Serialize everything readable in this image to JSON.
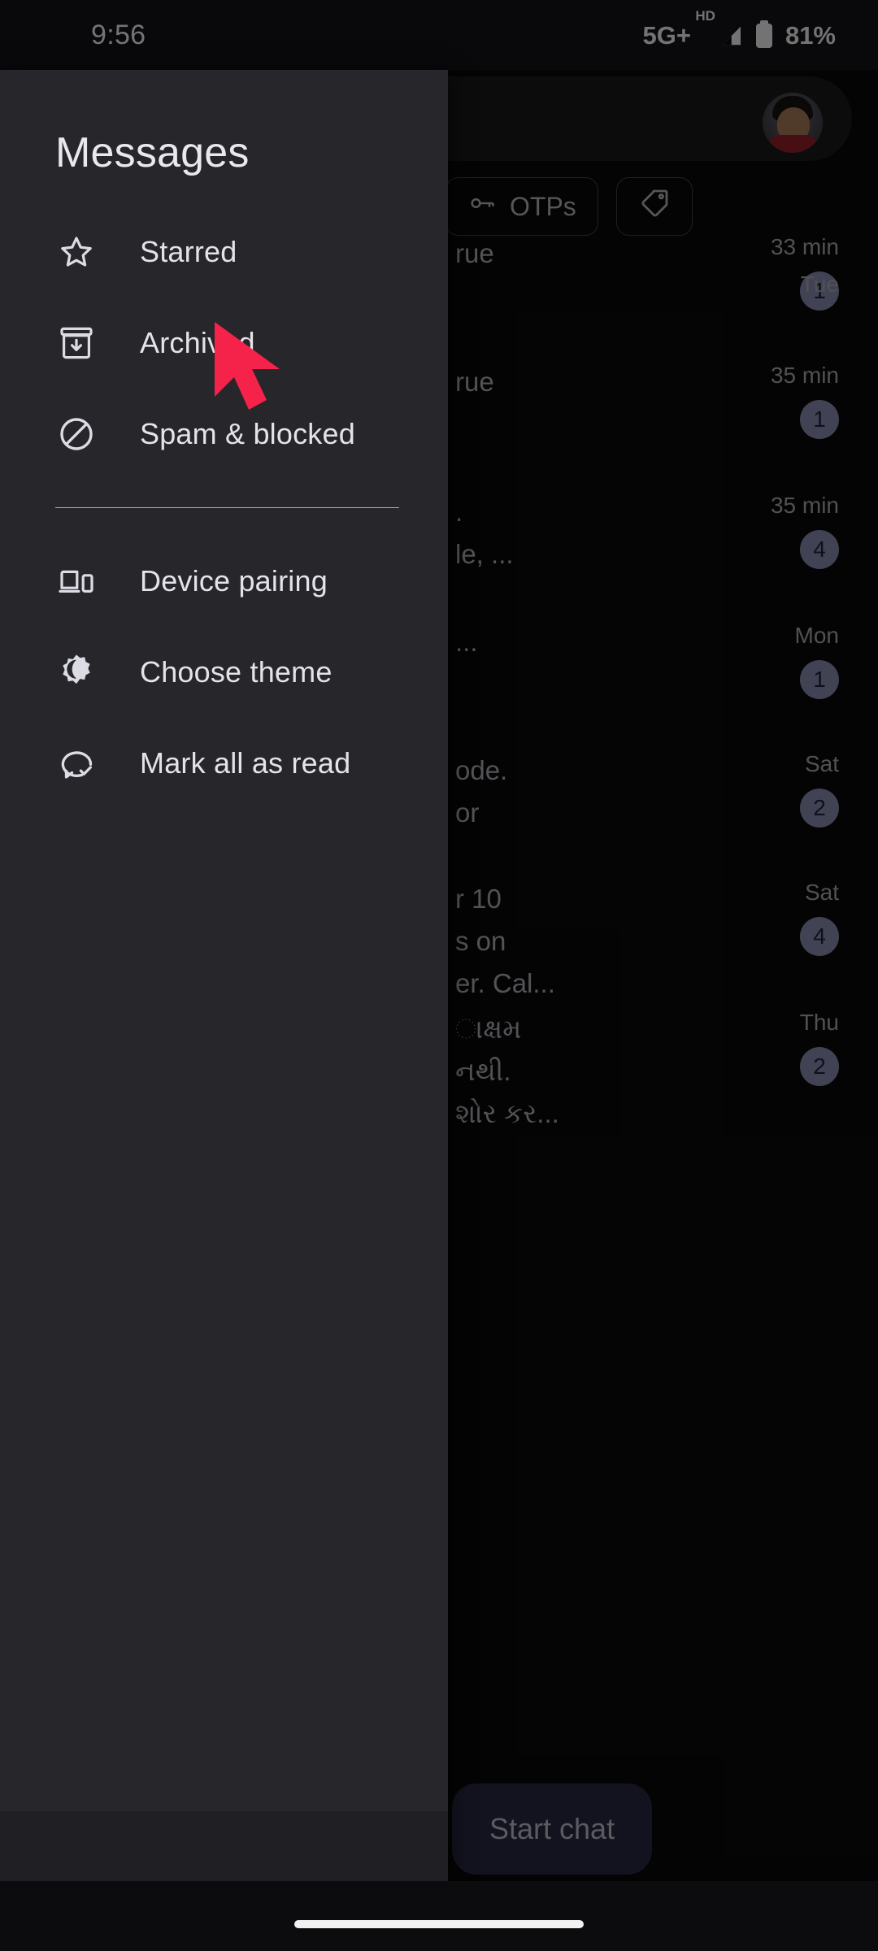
{
  "status_bar": {
    "time": "9:56",
    "network_label": "5G+",
    "network_sub": "HD",
    "battery_percent": "81%"
  },
  "drawer": {
    "title": "Messages",
    "items_top": [
      {
        "label": "Starred",
        "icon": "star-icon"
      },
      {
        "label": "Archived",
        "icon": "archive-icon"
      },
      {
        "label": "Spam & blocked",
        "icon": "block-icon"
      }
    ],
    "items_bottom": [
      {
        "label": "Device pairing",
        "icon": "device-pairing-icon"
      },
      {
        "label": "Choose theme",
        "icon": "theme-icon"
      },
      {
        "label": "Mark all as read",
        "icon": "mark-read-icon"
      }
    ]
  },
  "background_app": {
    "chips": [
      {
        "label": "OTPs",
        "icon": "key-icon"
      },
      {
        "label": "",
        "icon": "tag-icon"
      }
    ],
    "conversations": [
      {
        "snippet": "rue",
        "time": "33 min",
        "badge": "1"
      },
      {
        "snippet": "rue",
        "time": "35 min",
        "badge": "1"
      },
      {
        "snippet": ".\nle, ...",
        "time": "35 min",
        "badge": "4"
      },
      {
        "snippet": "...",
        "time": "Mon",
        "badge": "1"
      },
      {
        "snippet": "ode.\nor",
        "time": "Sat",
        "badge": "2"
      },
      {
        "snippet": "r 10\ns on\ner. Cal...",
        "time": "Sat",
        "badge": "4"
      },
      {
        "snippet": "ાક્ષમ\nનથી.\nશોર કર...",
        "time": "Thu",
        "badge": "2"
      },
      {
        "snippet": "",
        "time": "Tue",
        "badge": ""
      }
    ],
    "fab_label": "Start chat"
  },
  "colors": {
    "drawer_bg": "#26262b",
    "badge_bg": "#9094ba",
    "fab_bg": "#2a2a46",
    "cursor_red": "#f5234a"
  }
}
